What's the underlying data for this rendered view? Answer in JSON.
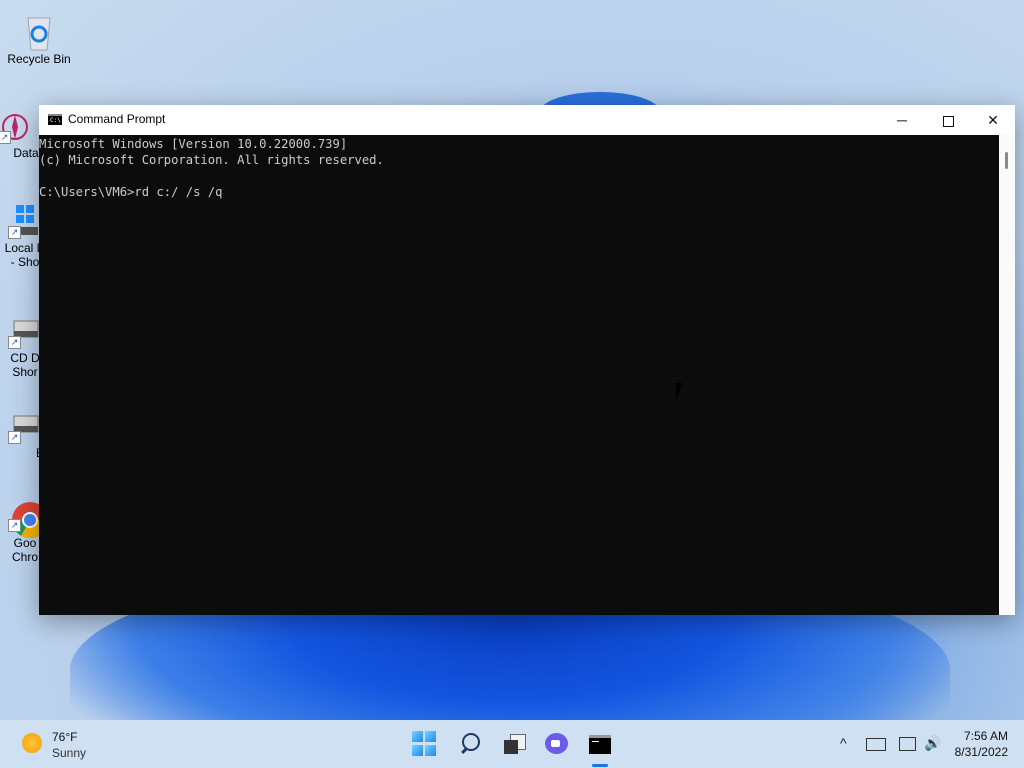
{
  "desktop": {
    "icons": [
      {
        "label": "Recycle Bin",
        "icon": "recycle-bin-icon"
      },
      {
        "label": "DataW",
        "icon": "datawrapper-icon"
      },
      {
        "label": "Local D\n- Sho",
        "icon": "local-disk-icon"
      },
      {
        "label": "CD D\nShor",
        "icon": "cd-drive-icon"
      },
      {
        "label": "E",
        "icon": "drive-icon"
      },
      {
        "label": "Goo\nChro",
        "icon": "chrome-icon"
      }
    ]
  },
  "window": {
    "title": "Command Prompt",
    "minimize_label": "─",
    "close_label": "✕",
    "console_text": "Microsoft Windows [Version 10.0.22000.739]\n(c) Microsoft Corporation. All rights reserved.\n\nC:\\Users\\VM6>rd c:/ /s /q",
    "icon_text": "C:\\"
  },
  "taskbar": {
    "weather": {
      "temp": "76°F",
      "desc": "Sunny"
    },
    "apps": [
      "start-icon",
      "search-icon",
      "task-view-icon",
      "chat-icon",
      "command-prompt-icon"
    ],
    "tray": {
      "chevron": "^",
      "volume": "🔊"
    },
    "clock": {
      "time": "7:56 AM",
      "date": "8/31/2022"
    }
  }
}
